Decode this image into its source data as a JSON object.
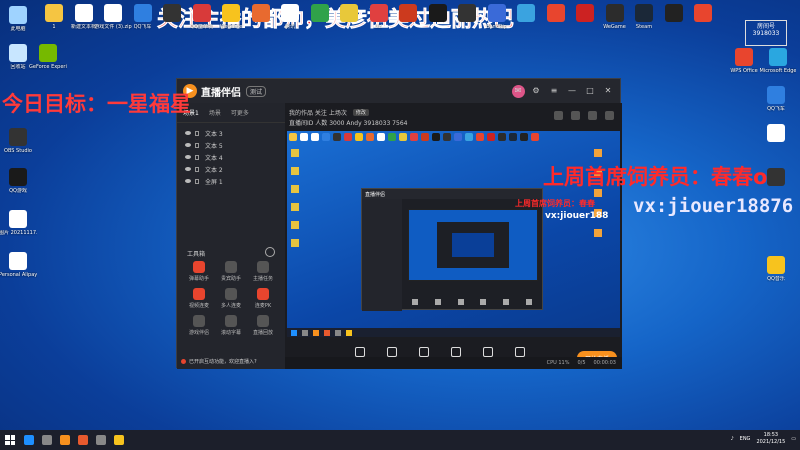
{
  "overlays": {
    "top": "关注主播的都帅，美彦祖美过迪丽热巴",
    "left": "今日目标：一星福星",
    "right1": "上周首席饲养员：春春o",
    "right2": "vx:jiouer18876",
    "inner1": "上周首席饲养员：春春",
    "inner2": "vx:jiouer188"
  },
  "desktop_icons_left": [
    {
      "label": "此电脑",
      "color": "#9fd3ff"
    },
    {
      "label": "回收站",
      "color": "#c8e6ff"
    },
    {
      "label": "OBS Studio",
      "color": "#333333"
    },
    {
      "label": "QQ游戏",
      "color": "#1a1a1a"
    },
    {
      "label": "图片 20211117...",
      "color": "#ffffff"
    },
    {
      "label": "Personal Alipay...",
      "color": "#ffffff"
    }
  ],
  "desktop_icons_top": [
    {
      "label": "1",
      "color": "#f5c542"
    },
    {
      "label": "新建文本档",
      "color": "#ffffff"
    },
    {
      "label": "游戏文件 (3).zip",
      "color": "#ffffff"
    },
    {
      "label": "QQ飞车",
      "color": "#2f7fe0"
    },
    {
      "label": "",
      "color": "#333333"
    },
    {
      "label": "QQ堂单机",
      "color": "#d83a3a"
    },
    {
      "label": "WeGame",
      "color": "#f7c31e"
    },
    {
      "label": "",
      "color": "#e86a2f"
    },
    {
      "label": "腾讯",
      "color": "#ffffff"
    },
    {
      "label": "",
      "color": "#30a24a"
    },
    {
      "label": "",
      "color": "#e8c83a"
    },
    {
      "label": "Uzi",
      "color": "#e04040"
    },
    {
      "label": "",
      "color": "#cc3a1e"
    },
    {
      "label": "",
      "color": "#1a1a1a"
    },
    {
      "label": "",
      "color": "#333333"
    },
    {
      "label": "BandRip",
      "color": "#3a6ad8"
    },
    {
      "label": "",
      "color": "#3aa3e0"
    },
    {
      "label": "",
      "color": "#e8452e"
    },
    {
      "label": "",
      "color": "#cc2222"
    },
    {
      "label": "WeGame",
      "color": "#2c2c2c"
    },
    {
      "label": "Steam",
      "color": "#1b2838"
    },
    {
      "label": "",
      "color": "#222222"
    },
    {
      "label": "",
      "color": "#e8452e"
    }
  ],
  "desktop_icons_right": [
    {
      "label": "GeForce Experience",
      "color": "#76b900"
    },
    {
      "label": "WPS Office",
      "color": "#e8452e"
    },
    {
      "label": "Microsoft Edge",
      "color": "#2aa7e0"
    },
    {
      "label": "QQ飞车",
      "color": "#2f7fe0"
    },
    {
      "label": "",
      "color": "#ffffff"
    },
    {
      "label": "",
      "color": "#333333"
    },
    {
      "label": "QQ音乐",
      "color": "#f7c31e"
    }
  ],
  "app": {
    "brand": "直播伴侣",
    "version": "测试",
    "side_tabs": [
      "场景1",
      "场景",
      "可更多"
    ],
    "scenes": [
      "文本 3",
      "文本 5",
      "文本 4",
      "文本 2",
      "全屏 1"
    ],
    "tools_title": "工具箱",
    "tools": [
      {
        "label": "弹幕助手",
        "red": true
      },
      {
        "label": "贵宾助手",
        "red": false
      },
      {
        "label": "主播任务",
        "red": false
      },
      {
        "label": "视频连麦",
        "red": true
      },
      {
        "label": "多人连麦",
        "red": false
      },
      {
        "label": "连麦PK",
        "red": true
      },
      {
        "label": "游戏伴侣",
        "red": false
      },
      {
        "label": "滚动字幕",
        "red": false
      },
      {
        "label": "直播回放",
        "red": false
      }
    ],
    "footer_note": "已开启互动功能，欢迎直播入?",
    "info_line1": "我的作品 关注 上场次",
    "info_tag": "修改",
    "info_line2": "直播间ID 人数 3000 Andy 3918033 7564",
    "bottom_tools": [
      "直播设置",
      "摄像头",
      "手机投屏",
      "多媒体",
      "麦克风",
      "扬声器"
    ],
    "start_label": "开始直播",
    "status_time": "00:00:03",
    "status_rate": "0/5",
    "status_cpu": "CPU 11%"
  },
  "corner_badge": "房间号 3918033",
  "taskbar": {
    "apps": [
      "#1e90ff",
      "#888888",
      "#f7901e",
      "#e85a2e",
      "#888888",
      "#f7c31e"
    ],
    "lang": "ENG",
    "time": "18:53",
    "date": "2021/12/15"
  }
}
